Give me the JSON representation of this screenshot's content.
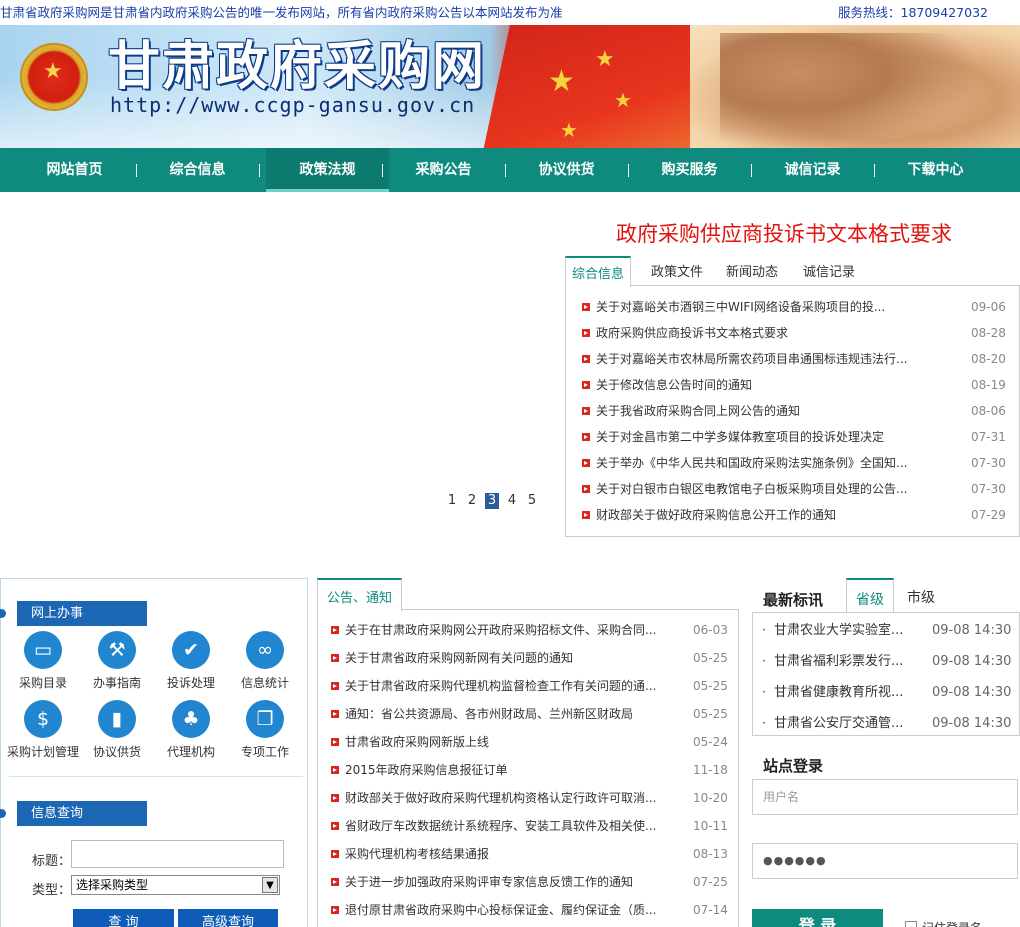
{
  "topbar": {
    "notice": "甘肃省政府采购网是甘肃省内政府采购公告的唯一发布网站，所有省内政府采购公告以本网站发布为准",
    "hotline": "服务热线：18709427032"
  },
  "banner": {
    "title": "甘肃政府采购网",
    "url": "http://www.ccgp-gansu.gov.cn"
  },
  "nav": {
    "items": [
      "网站首页",
      "综合信息",
      "政策法规",
      "采购公告",
      "协议供货",
      "购买服务",
      "诚信记录",
      "下载中心"
    ],
    "active_index": 2
  },
  "feature": {
    "headline": "政府采购供应商投诉书文本格式要求",
    "pager": [
      "1",
      "2",
      "3",
      "4",
      "5"
    ],
    "pager_current": 3
  },
  "news_tabs": [
    "综合信息",
    "政策文件",
    "新闻动态",
    "诚信记录"
  ],
  "news_list": [
    {
      "title": "关于对嘉峪关市酒钢三中WIFI网络设备采购项目的投...",
      "date": "09-06"
    },
    {
      "title": "政府采购供应商投诉书文本格式要求",
      "date": "08-28"
    },
    {
      "title": "关于对嘉峪关市农林局所需农药项目串通围标违规违法行...",
      "date": "08-20"
    },
    {
      "title": "关于修改信息公告时间的通知",
      "date": "08-19"
    },
    {
      "title": "关于我省政府采购合同上网公告的通知",
      "date": "08-06"
    },
    {
      "title": "关于对金昌市第二中学多媒体教室项目的投诉处理决定",
      "date": "07-31"
    },
    {
      "title": "关于举办《中华人民共和国政府采购法实施条例》全国知...",
      "date": "07-30"
    },
    {
      "title": "关于对白银市白银区电教馆电子白板采购项目处理的公告...",
      "date": "07-30"
    },
    {
      "title": "财政部关于做好政府采购信息公开工作的通知",
      "date": "07-29"
    }
  ],
  "online": {
    "heading": "网上办事",
    "services": [
      {
        "label": "采购目录",
        "icon": "card-icon"
      },
      {
        "label": "办事指南",
        "icon": "wrench-icon"
      },
      {
        "label": "投诉处理",
        "icon": "check-icon"
      },
      {
        "label": "信息统计",
        "icon": "link-icon"
      },
      {
        "label": "采购计划管理",
        "icon": "money-icon"
      },
      {
        "label": "协议供货",
        "icon": "chart-icon"
      },
      {
        "label": "代理机构",
        "icon": "tree-icon"
      },
      {
        "label": "专项工作",
        "icon": "copy-icon"
      }
    ]
  },
  "query": {
    "heading": "信息查询",
    "title_label": "标题：",
    "type_label": "类型：",
    "type_value": "选择采购类型",
    "search_btn": "查 询",
    "advanced_btn": "高级查询"
  },
  "notices": {
    "tab": "公告、通知",
    "items": [
      {
        "title": "关于在甘肃政府采购网公开政府采购招标文件、采购合同...",
        "date": "06-03"
      },
      {
        "title": "关于甘肃省政府采购网新网有关问题的通知",
        "date": "05-25"
      },
      {
        "title": "关于甘肃省政府采购代理机构监督检查工作有关问题的通...",
        "date": "05-25"
      },
      {
        "title": "通知：省公共资源局、各市州财政局、兰州新区财政局",
        "date": "05-25"
      },
      {
        "title": "甘肃省政府采购网新版上线",
        "date": "05-24"
      },
      {
        "title": "2015年政府采购信息报征订单",
        "date": "11-18"
      },
      {
        "title": "财政部关于做好政府采购代理机构资格认定行政许可取消...",
        "date": "10-20"
      },
      {
        "title": "省财政厅车改数据统计系统程序、安装工具软件及相关使...",
        "date": "10-11"
      },
      {
        "title": "采购代理机构考核结果通报",
        "date": "08-13"
      },
      {
        "title": "关于进一步加强政府采购评审专家信息反馈工作的通知",
        "date": "07-25"
      },
      {
        "title": "退付原甘肃省政府采购中心投标保证金、履约保证金（质...",
        "date": "07-14"
      }
    ]
  },
  "latest": {
    "title": "最新标讯",
    "tabs": [
      "省级",
      "市级"
    ],
    "items": [
      {
        "title": "甘肃农业大学实验室...",
        "time": "09-08 14:30"
      },
      {
        "title": "甘肃省福利彩票发行...",
        "time": "09-08 14:30"
      },
      {
        "title": "甘肃省健康教育所视...",
        "time": "09-08 14:30"
      },
      {
        "title": "甘肃省公安厅交通管...",
        "time": "09-08 14:30"
      }
    ]
  },
  "login": {
    "title": "站点登录",
    "username_placeholder": "用户名",
    "password_value": "●●●●●●",
    "login_btn": "登 录",
    "remember": "记住登录名"
  },
  "colors": {
    "teal": "#0f8a7e",
    "blue": "#1b67b4",
    "red": "#e3140f"
  }
}
